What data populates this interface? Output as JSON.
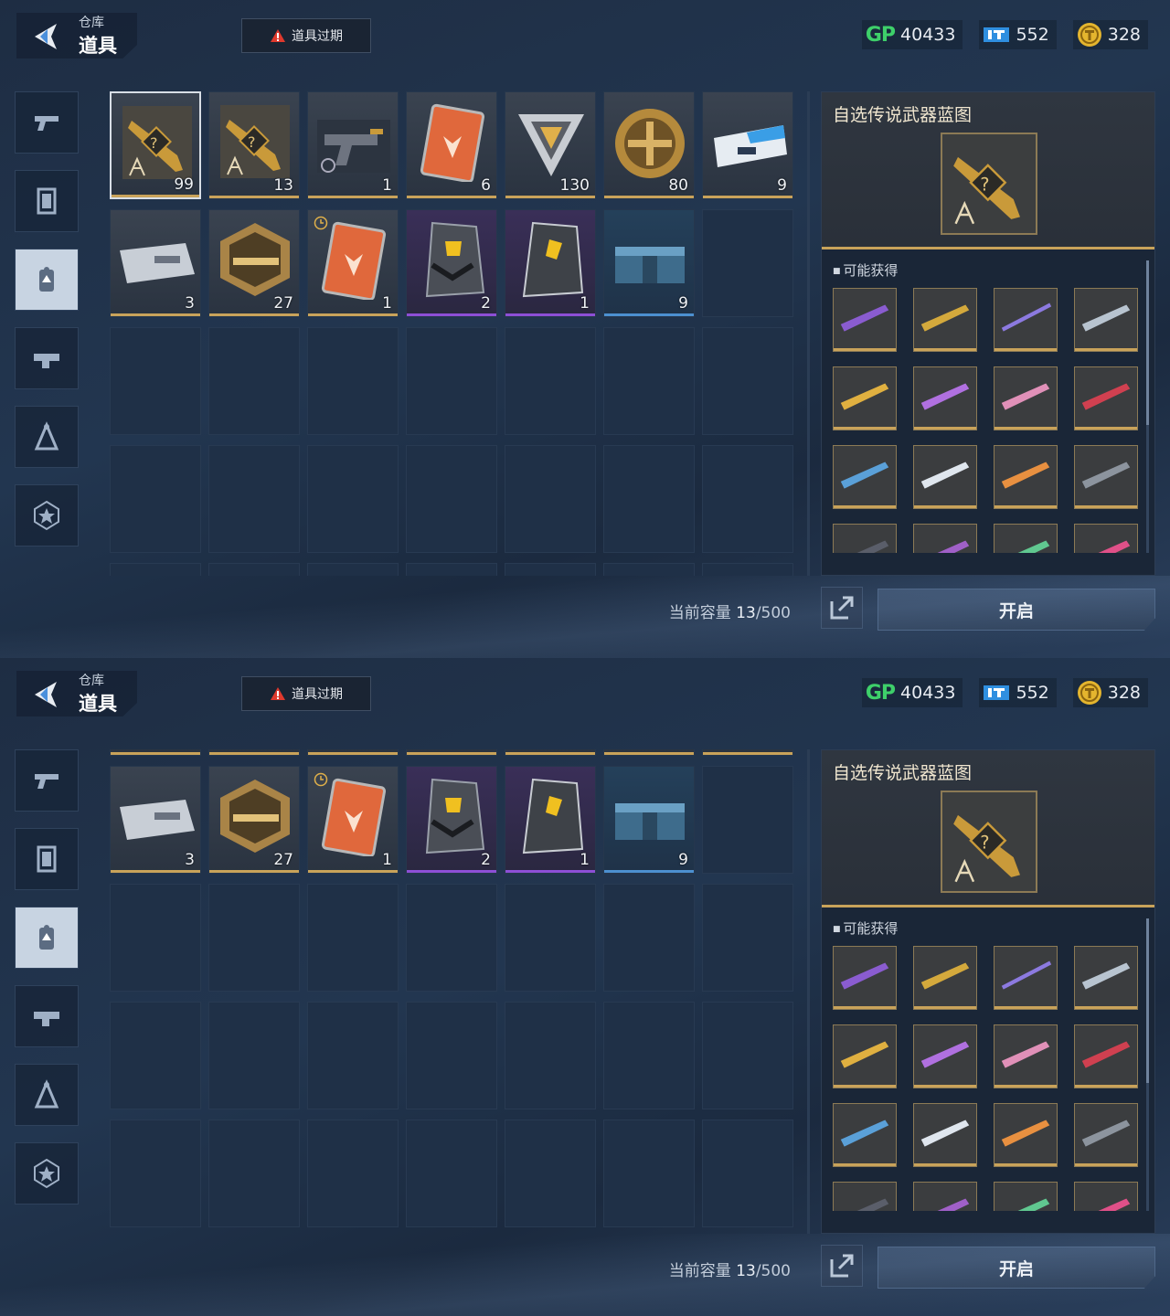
{
  "header": {
    "breadcrumb": "仓库",
    "title": "道具",
    "expire_button": "道具过期"
  },
  "currencies": [
    {
      "icon": "gp-icon",
      "label": "GP",
      "value": "40433"
    },
    {
      "icon": "ticket-icon",
      "value": "552"
    },
    {
      "icon": "gold-coin-icon",
      "value": "328"
    }
  ],
  "sidebar": [
    {
      "icon": "pistol-icon"
    },
    {
      "icon": "card-frame-icon"
    },
    {
      "icon": "item-tag-icon",
      "active": true
    },
    {
      "icon": "attachment-icon"
    },
    {
      "icon": "blueprint-icon"
    },
    {
      "icon": "star-badge-icon"
    }
  ],
  "inventory": {
    "items": [
      {
        "name": "legendary-blueprint",
        "count": "99",
        "rarity": "gold",
        "selected": true
      },
      {
        "name": "legendary-blueprint",
        "count": "13",
        "rarity": "gold"
      },
      {
        "name": "timed-pistol",
        "count": "1",
        "rarity": "gold"
      },
      {
        "name": "orange-card",
        "count": "6",
        "rarity": "gold"
      },
      {
        "name": "triangle-token",
        "count": "130",
        "rarity": "gold"
      },
      {
        "name": "gold-medal",
        "count": "80",
        "rarity": "gold"
      },
      {
        "name": "blue-ticket",
        "count": "9",
        "rarity": "gold"
      },
      {
        "name": "silver-case",
        "count": "3",
        "rarity": "gold"
      },
      {
        "name": "rifle-hex-badge",
        "count": "27",
        "rarity": "gold"
      },
      {
        "name": "timed-orange-card",
        "count": "1",
        "rarity": "gold",
        "timer": true
      },
      {
        "name": "purple-shield-card",
        "count": "2",
        "rarity": "purple"
      },
      {
        "name": "purple-tag-card",
        "count": "1",
        "rarity": "purple"
      },
      {
        "name": "blue-supply-box",
        "count": "9",
        "rarity": "blue"
      }
    ],
    "capacity_label": "当前容量",
    "capacity_used": "13",
    "capacity_total": "/500"
  },
  "panel": {
    "title": "自选传说武器蓝图",
    "may_get_label": "可能获得",
    "rewards": [
      "purple-rifle",
      "gold-smg",
      "purple-sniper",
      "silver-rifle",
      "gold-rifle",
      "purple-shotgun",
      "pink-rifle",
      "red-rifle",
      "blue-pistol",
      "white-shotgun",
      "orange-rifle",
      "grey-rifle",
      "dark-rifle",
      "purple-rifle-2",
      "green-rifle",
      "pink-smg"
    ],
    "open_button": "开启"
  },
  "colors": {
    "gold": "#c9a35a",
    "purple": "#8d4fd6",
    "blue": "#4c90d0",
    "gp": "#3ed06a"
  }
}
